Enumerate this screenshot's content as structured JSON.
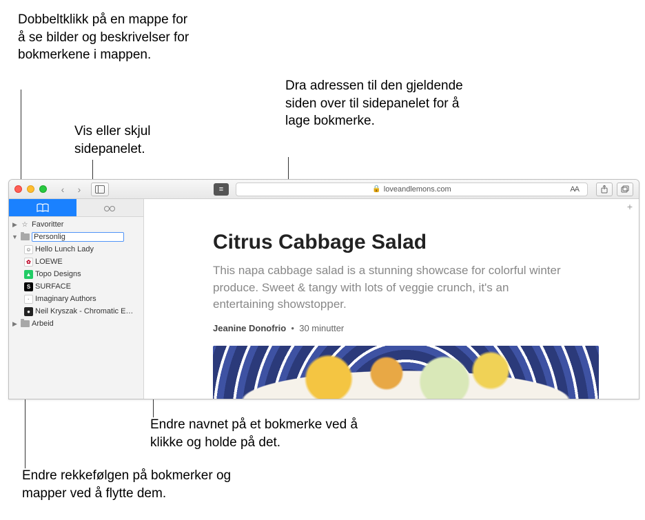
{
  "callouts": {
    "doubleclick": "Dobbeltklikk på en mappe for å se bilder og beskrivelser for bokmerkene i mappen.",
    "toggle_sidebar": "Vis eller skjul sidepanelet.",
    "drag_address": "Dra adressen til den gjeldende siden over til sidepanelet for å lage bokmerke.",
    "rename": "Endre navnet på et bokmerke ved å klikke og holde på det.",
    "reorder": "Endre rekkefølgen på bokmerker og mapper ved å flytte dem."
  },
  "toolbar": {
    "address": "loveandlemons.com",
    "reader_aa": "AA"
  },
  "sidebar": {
    "folders": {
      "favorites": "Favoritter",
      "personal": "Personlig",
      "work": "Arbeid"
    },
    "bookmarks": [
      {
        "label": "Hello Lunch Lady",
        "bg": "#fff",
        "fg": "#333",
        "initial": "☺"
      },
      {
        "label": "LOEWE",
        "bg": "#fff",
        "fg": "#b02",
        "initial": "✿"
      },
      {
        "label": "Topo Designs",
        "bg": "#2c6",
        "fg": "#fff",
        "initial": "▲"
      },
      {
        "label": "SURFACE",
        "bg": "#000",
        "fg": "#fff",
        "initial": "S"
      },
      {
        "label": "Imaginary Authors",
        "bg": "#fff",
        "fg": "#888",
        "initial": "·"
      },
      {
        "label": "Neil Kryszak - Chromatic E…",
        "bg": "#222",
        "fg": "#fff",
        "initial": "●"
      }
    ]
  },
  "article": {
    "title": "Citrus Cabbage Salad",
    "subtitle": "This napa cabbage salad is a stunning showcase for colorful winter produce. Sweet & tangy with lots of veggie crunch, it's an entertaining showstopper.",
    "author": "Jeanine Donofrio",
    "separator": "•",
    "duration": "30 minutter"
  }
}
